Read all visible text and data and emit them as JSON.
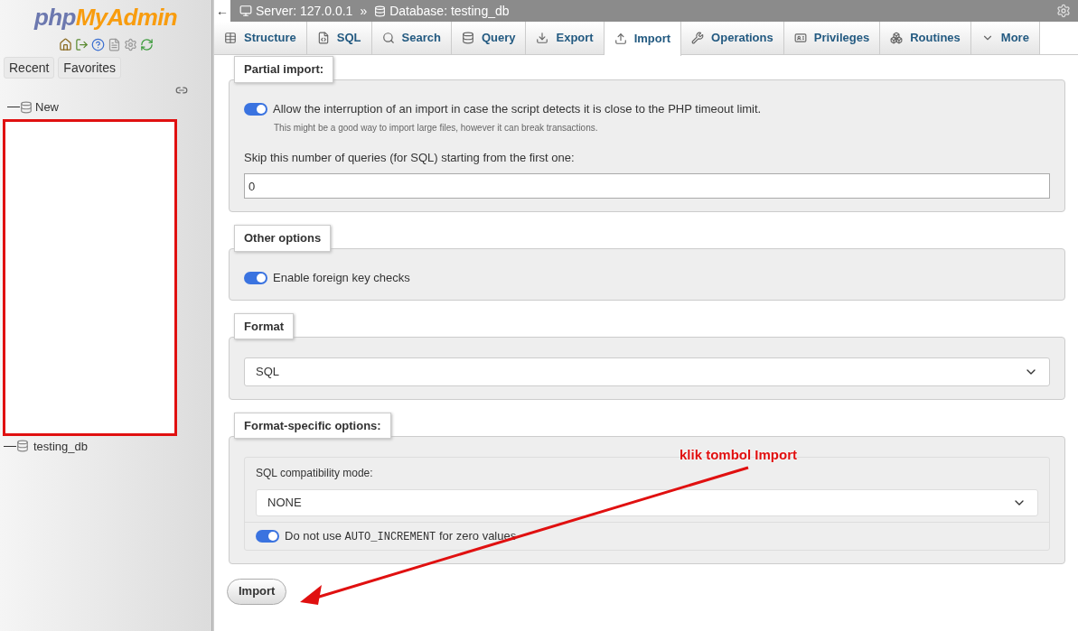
{
  "sidebar": {
    "logo": {
      "php": "php",
      "brand": "MyAdmin"
    },
    "tabs": [
      "Recent",
      "Favorites"
    ],
    "tree": [
      {
        "label": "New"
      },
      {
        "label": "testing_db"
      }
    ]
  },
  "breadcrumb": {
    "back": "←",
    "separator": "»",
    "items": [
      {
        "kind": "server",
        "label": "Server: 127.0.0.1"
      },
      {
        "kind": "database",
        "label": "Database: testing_db"
      }
    ]
  },
  "tabs": [
    {
      "label": "Structure",
      "selected": false
    },
    {
      "label": "SQL",
      "selected": false
    },
    {
      "label": "Search",
      "selected": false
    },
    {
      "label": "Query",
      "selected": false
    },
    {
      "label": "Export",
      "selected": false
    },
    {
      "label": "Import",
      "selected": true
    },
    {
      "label": "Operations",
      "selected": false
    },
    {
      "label": "Privileges",
      "selected": false
    },
    {
      "label": "Routines",
      "selected": false
    },
    {
      "label": "More",
      "selected": false
    }
  ],
  "partial_import": {
    "legend": "Partial import:",
    "toggle": {
      "label": "Allow the interruption of an import in case the script detects it is close to the PHP timeout limit.",
      "on": true
    },
    "hint": "This might be a good way to import large files, however it can break transactions.",
    "skip_label": "Skip this number of queries (for SQL) starting from the first one:",
    "skip_value": "0"
  },
  "other_options": {
    "legend": "Other options",
    "toggle": {
      "label": "Enable foreign key checks",
      "on": true
    }
  },
  "format": {
    "legend": "Format",
    "value": "SQL"
  },
  "format_specific": {
    "legend": "Format-specific options:",
    "compat_label": "SQL compatibility mode:",
    "compat_value": "NONE",
    "toggle": {
      "before": "Do not use",
      "code": "AUTO_INCREMENT",
      "after": "for zero values",
      "on": true
    }
  },
  "import_button": "Import",
  "annotation": "klik tombol Import"
}
